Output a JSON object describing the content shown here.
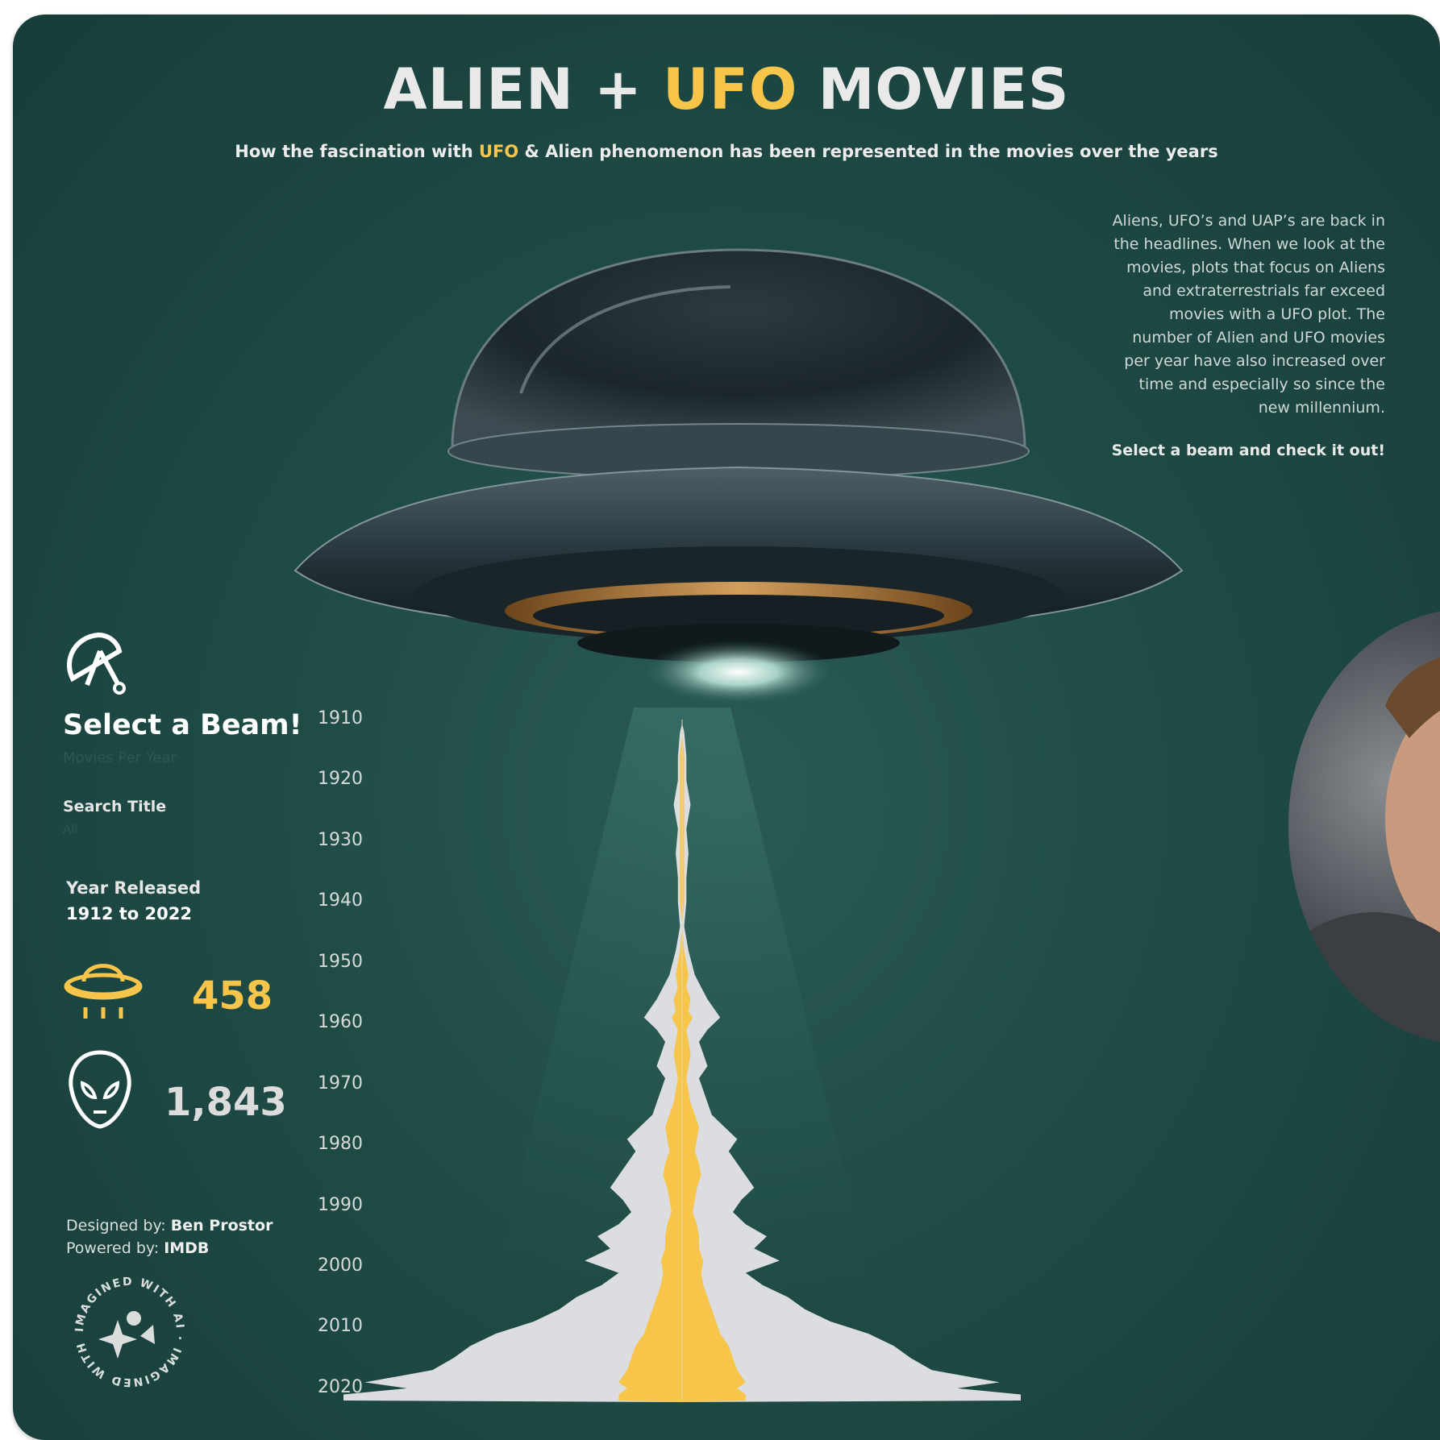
{
  "header": {
    "title_part1": "ALIEN + ",
    "title_accent": "UFO",
    "title_part2": " MOVIES",
    "subtitle_part1": "How the fascination with ",
    "subtitle_accent": "UFO",
    "subtitle_part2": " & Alien phenomenon has been represented in the movies over the years"
  },
  "intro": {
    "text": "Aliens, UFO’s and UAP’s are back in the headlines. When we look at the movies, plots that focus on Aliens and extraterrestrials far exceed movies with a UFO plot. The number of Alien and UFO movies per year have also increased over time and especially so since the new millennium.",
    "cta": "Select a beam and check it out!"
  },
  "sidebar": {
    "select_title": "Select a Beam!",
    "select_subtitle": "Movies Per Year",
    "search_label": "Search Title",
    "search_value": "All",
    "year_released_label": "Year Released",
    "year_range": "1912 to 2022",
    "ufo_total": "458",
    "alien_total": "1,843",
    "designed_by_label": "Designed by: ",
    "designed_by_name": "Ben Prostor",
    "powered_by_label": "Powered by: ",
    "powered_by_name": "IMDB",
    "badge_text": "IMAGINED WITH AI · IMAGINED WITH AI"
  },
  "colors": {
    "background": "#1f4b45",
    "ufo_accent": "#f6c54a",
    "alien_beam": "#dcdde0",
    "text": "#e9e9e9"
  },
  "chart_data": {
    "type": "area",
    "orientation": "vertical mirrored beam",
    "y_ticks": [
      "1910",
      "1920",
      "1930",
      "1940",
      "1950",
      "1960",
      "1970",
      "1980",
      "1990",
      "2000",
      "2010",
      "2020"
    ],
    "ylim": [
      1910,
      2022
    ],
    "series": [
      {
        "name": "Alien",
        "color": "#dcdde0",
        "points": [
          [
            1912,
            1
          ],
          [
            1916,
            2
          ],
          [
            1920,
            2
          ],
          [
            1924,
            4
          ],
          [
            1928,
            2
          ],
          [
            1932,
            3
          ],
          [
            1936,
            2
          ],
          [
            1940,
            2
          ],
          [
            1944,
            1
          ],
          [
            1948,
            3
          ],
          [
            1952,
            6
          ],
          [
            1954,
            9
          ],
          [
            1956,
            12
          ],
          [
            1958,
            16
          ],
          [
            1959,
            18
          ],
          [
            1961,
            12
          ],
          [
            1963,
            8
          ],
          [
            1965,
            10
          ],
          [
            1967,
            12
          ],
          [
            1969,
            8
          ],
          [
            1971,
            10
          ],
          [
            1973,
            12
          ],
          [
            1975,
            14
          ],
          [
            1977,
            20
          ],
          [
            1979,
            26
          ],
          [
            1981,
            22
          ],
          [
            1983,
            26
          ],
          [
            1985,
            30
          ],
          [
            1987,
            34
          ],
          [
            1989,
            28
          ],
          [
            1991,
            24
          ],
          [
            1993,
            30
          ],
          [
            1995,
            40
          ],
          [
            1997,
            34
          ],
          [
            1999,
            46
          ],
          [
            2001,
            30
          ],
          [
            2003,
            38
          ],
          [
            2005,
            50
          ],
          [
            2007,
            58
          ],
          [
            2009,
            70
          ],
          [
            2011,
            88
          ],
          [
            2013,
            100
          ],
          [
            2015,
            108
          ],
          [
            2017,
            118
          ],
          [
            2019,
            150
          ],
          [
            2020,
            130
          ],
          [
            2021,
            160
          ],
          [
            2022,
            160
          ]
        ]
      },
      {
        "name": "UFO",
        "color": "#f6c54a",
        "points": [
          [
            1912,
            0
          ],
          [
            1916,
            1
          ],
          [
            1920,
            1
          ],
          [
            1924,
            1
          ],
          [
            1928,
            1
          ],
          [
            1932,
            1
          ],
          [
            1936,
            1
          ],
          [
            1940,
            1
          ],
          [
            1944,
            0
          ],
          [
            1948,
            1
          ],
          [
            1952,
            3
          ],
          [
            1954,
            2
          ],
          [
            1956,
            4
          ],
          [
            1958,
            3
          ],
          [
            1959,
            5
          ],
          [
            1961,
            2
          ],
          [
            1963,
            3
          ],
          [
            1965,
            4
          ],
          [
            1967,
            3
          ],
          [
            1969,
            2
          ],
          [
            1971,
            3
          ],
          [
            1973,
            4
          ],
          [
            1975,
            6
          ],
          [
            1977,
            8
          ],
          [
            1979,
            7
          ],
          [
            1981,
            6
          ],
          [
            1983,
            8
          ],
          [
            1985,
            9
          ],
          [
            1987,
            7
          ],
          [
            1989,
            6
          ],
          [
            1991,
            5
          ],
          [
            1993,
            7
          ],
          [
            1995,
            8
          ],
          [
            1997,
            8
          ],
          [
            1999,
            10
          ],
          [
            2001,
            9
          ],
          [
            2003,
            10
          ],
          [
            2005,
            12
          ],
          [
            2007,
            14
          ],
          [
            2009,
            16
          ],
          [
            2011,
            18
          ],
          [
            2013,
            22
          ],
          [
            2015,
            24
          ],
          [
            2017,
            26
          ],
          [
            2019,
            30
          ],
          [
            2020,
            26
          ],
          [
            2021,
            30
          ],
          [
            2022,
            30
          ]
        ]
      }
    ]
  }
}
